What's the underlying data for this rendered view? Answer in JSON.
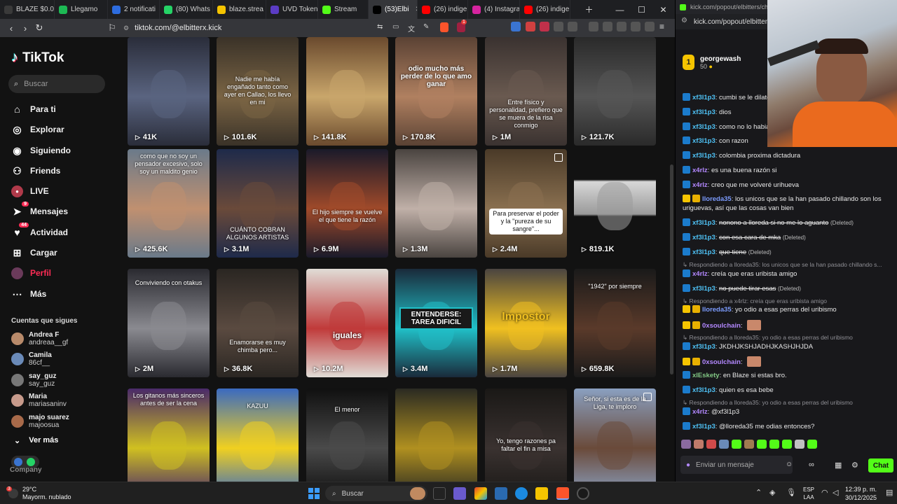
{
  "browser": {
    "tabs": [
      {
        "label": "BLAZE $0.0",
        "icon": "blaze-icon",
        "color": "#3a3a3a"
      },
      {
        "label": "Llegamo",
        "icon": "spotify-icon",
        "color": "#1db954"
      },
      {
        "label": "2 notificati",
        "icon": "notification-icon",
        "color": "#2d6cdf"
      },
      {
        "label": "(80) Whats",
        "icon": "whatsapp-icon",
        "color": "#25d366"
      },
      {
        "label": "blaze.strea",
        "icon": "document-icon",
        "color": "#f5c400"
      },
      {
        "label": "UVD Token",
        "icon": "token-icon",
        "color": "#5b3cc4"
      },
      {
        "label": "Stream",
        "icon": "kick-icon",
        "color": "#53fc18"
      },
      {
        "label": "(53)Elbi",
        "icon": "tiktok-icon",
        "color": "#000000",
        "active": true
      },
      {
        "label": "(26) indige",
        "icon": "youtube-icon",
        "color": "#ff0000"
      },
      {
        "label": "(4) Instagra",
        "icon": "instagram-icon",
        "color": "#d6249f"
      },
      {
        "label": "(26) indige",
        "icon": "youtube-icon",
        "color": "#ff0000"
      }
    ],
    "url": "tiktok.com/@elbitterx.kick",
    "brave_badge": "1"
  },
  "tiktok": {
    "logo": "TikTok",
    "search_placeholder": "Buscar",
    "nav": [
      {
        "label": "Para ti",
        "icon": "home-icon"
      },
      {
        "label": "Explorar",
        "icon": "compass-icon"
      },
      {
        "label": "Siguiendo",
        "icon": "following-icon"
      },
      {
        "label": "Friends",
        "icon": "friends-icon"
      },
      {
        "label": "LIVE",
        "icon": "live-icon"
      },
      {
        "label": "Mensajes",
        "icon": "messages-icon",
        "badge": "9"
      },
      {
        "label": "Actividad",
        "icon": "activity-icon",
        "badge": "44"
      },
      {
        "label": "Cargar",
        "icon": "upload-icon"
      },
      {
        "label": "Perfil",
        "icon": "profile-icon"
      },
      {
        "label": "Más",
        "icon": "more-icon"
      }
    ],
    "following_title": "Cuentas que sigues",
    "following": [
      {
        "name": "Andrea F",
        "handle": "andreaa__gf",
        "color": "#b88a6a"
      },
      {
        "name": "Camila",
        "handle": "86cf__",
        "color": "#6a8ab8"
      },
      {
        "name": "say_guz",
        "handle": "say_guz",
        "color": "#777777"
      },
      {
        "name": "Maria",
        "handle": "mariasaninv",
        "color": "#c79a8b"
      },
      {
        "name": "majo suarez",
        "handle": "majoosua",
        "color": "#a86a4a"
      }
    ],
    "see_more": "Ver más",
    "company": "Company",
    "videos": [
      {
        "views": "41K",
        "caption": "",
        "bg": "#2a2d3a",
        "accent": "#5a6480"
      },
      {
        "views": "101.6K",
        "caption": "Nadie me había engañado tanto como ayer en Callao, los llevo en mi",
        "bg": "#3a3228",
        "accent": "#7a6444"
      },
      {
        "views": "141.8K",
        "caption": "",
        "bg": "#6a4a2e",
        "accent": "#c9a66b"
      },
      {
        "views": "170.8K",
        "caption": "odio mucho más perder de lo que amo ganar",
        "bg": "#5a4234",
        "accent": "#b08060"
      },
      {
        "views": "1M",
        "caption": "Entre físico y personalidad, prefiero que se muera de la risa conmigo",
        "bg": "#3a3230",
        "accent": "#6a5a50"
      },
      {
        "views": "121.7K",
        "caption": "",
        "bg": "#2a2a2a",
        "accent": "#555555"
      },
      {
        "views": "425.6K",
        "caption": "como que no soy un pensador excesivo, solo soy un maldito genio",
        "bg": "#6a7a8a",
        "accent": "#c09070"
      },
      {
        "views": "3.1M",
        "caption": "CUÁNTO COBRAN ALGUNOS ARTISTAS",
        "bg": "#1e2a4a",
        "accent": "#6a4a3a"
      },
      {
        "views": "6.9M",
        "caption": "El hijo siempre se vuelve el que tiene la razón",
        "bg": "#1a1a2a",
        "accent": "#a04a2a"
      },
      {
        "views": "1.3M",
        "caption": "",
        "bg": "#4a4440",
        "accent": "#c0b0a8"
      },
      {
        "views": "2.4M",
        "caption": "Para preservar el poder y la \"pureza de su sangre\"...",
        "bg": "#4a3a28",
        "accent": "#8a7050"
      },
      {
        "views": "819.1K",
        "caption": "",
        "bg": "#121212",
        "accent": "#9a9a9a"
      },
      {
        "views": "2M",
        "caption": "Conviviendo con otakus",
        "bg": "#2a2a30",
        "accent": "#8a8a90"
      },
      {
        "views": "36.8K",
        "caption": "Enamorarse es muy chimba pero...",
        "bg": "#2a2622",
        "accent": "#5a4a40"
      },
      {
        "views": "10.2M",
        "caption": "iguales",
        "bg": "#e0dcd6",
        "accent": "#c03a3a"
      },
      {
        "views": "3.4M",
        "caption": "ENTENDERSE: TAREA DIFICIL",
        "bg": "#1a2a3a",
        "accent": "#20c0c8"
      },
      {
        "views": "1.7M",
        "caption": "Impostor",
        "bg": "#4a4440",
        "accent": "#f0c020"
      },
      {
        "views": "659.8K",
        "caption": "\"1942\" por siempre",
        "bg": "#1a1a1a",
        "accent": "#5a3a2a"
      },
      {
        "views": "",
        "caption": "Los gitanos más sinceros antes de ser la cena",
        "bg": "#4a2a6a",
        "accent": "#d0c020"
      },
      {
        "views": "",
        "caption": "KAZUU",
        "bg": "#3a6ac0",
        "accent": "#f0d020"
      },
      {
        "views": "",
        "caption": "El menor",
        "bg": "#101010",
        "accent": "#4a4a4a"
      },
      {
        "views": "",
        "caption": "",
        "bg": "#2a2a22",
        "accent": "#b09020"
      },
      {
        "views": "",
        "caption": "Yo, tengo razones pa faltar el fin a misa",
        "bg": "#1a1816",
        "accent": "#3a3230"
      },
      {
        "views": "",
        "caption": "Señor, si esta es de la Liga, te imploro",
        "bg": "#8aa0c0",
        "accent": "#6a4a3a"
      }
    ]
  },
  "kick": {
    "top_label": "kick.com/popout/elbitters/chat",
    "url": "kick.com/popout/elbitten",
    "pinned_user": "georgewash",
    "pinned_count": "50",
    "messages": [
      {
        "type": "msg",
        "user": "xf3l1p3",
        "badge": "#1b7bcc",
        "ucolor": "#4fc3f7",
        "text": "cumbi se le dilato"
      },
      {
        "type": "msg",
        "user": "xf3l1p3",
        "badge": "#1b7bcc",
        "ucolor": "#4fc3f7",
        "text": "dios"
      },
      {
        "type": "msg",
        "user": "xf3l1p3",
        "badge": "#1b7bcc",
        "ucolor": "#4fc3f7",
        "text": "como no lo habia"
      },
      {
        "type": "msg",
        "user": "xf3l1p3",
        "badge": "#1b7bcc",
        "ucolor": "#4fc3f7",
        "text": "con razon"
      },
      {
        "type": "msg",
        "user": "xf3l1p3",
        "badge": "#1b7bcc",
        "ucolor": "#4fc3f7",
        "text": "colombia proxima dictadura"
      },
      {
        "type": "msg",
        "user": "x4rlz",
        "badge": "#1b7bcc",
        "ucolor": "#b388ff",
        "text": "es una buena razón si"
      },
      {
        "type": "msg",
        "user": "x4rlz",
        "badge": "#1b7bcc",
        "ucolor": "#b388ff",
        "text": "creo que me volveré urihueva"
      },
      {
        "type": "msg",
        "user": "lloreda35",
        "badge": "#f5c400",
        "ucolor": "#7c9cff",
        "text": "los unicos que se la han pasado chillando son los uriguevas, así que las cosas van bien"
      },
      {
        "type": "msg",
        "user": "xf3l1p3",
        "badge": "#1b7bcc",
        "ucolor": "#4fc3f7",
        "text": "nonono a lloreda si no me lo aguanto",
        "deleted": "(Deleted)"
      },
      {
        "type": "msg",
        "user": "xf3l1p3",
        "badge": "#1b7bcc",
        "ucolor": "#4fc3f7",
        "text": "con esa cara de mka",
        "deleted": "(Deleted)"
      },
      {
        "type": "msg",
        "user": "xf3l1p3",
        "badge": "#1b7bcc",
        "ucolor": "#4fc3f7",
        "text": "que tiene",
        "deleted": "(Deleted)"
      },
      {
        "type": "reply",
        "text": "Respondiendo a lloreda35: los unicos que se la han pasado chillando s..."
      },
      {
        "type": "msg",
        "user": "x4rlz",
        "badge": "#1b7bcc",
        "ucolor": "#b388ff",
        "text": "creía que eras uribista amigo"
      },
      {
        "type": "msg",
        "user": "xf3l1p3",
        "badge": "#1b7bcc",
        "ucolor": "#4fc3f7",
        "text": "no puede tirar esas",
        "deleted": "(Deleted)"
      },
      {
        "type": "reply",
        "text": "Respondiendo a x4rlz: creía que eras uribista amigo"
      },
      {
        "type": "msg",
        "user": "lloreda35",
        "badge": "#f5c400",
        "ucolor": "#7c9cff",
        "text": "yo odio a esas perras del uribismo"
      },
      {
        "type": "msg",
        "user": "0xsoulchain",
        "badge": "#f5c400",
        "ucolor": "#b388ff",
        "text": "",
        "emote": true
      },
      {
        "type": "reply",
        "text": "Respondiendo a lloreda35: yo odio a esas perras del uribismo"
      },
      {
        "type": "msg",
        "user": "xf3l1p3",
        "badge": "#1b7bcc",
        "ucolor": "#4fc3f7",
        "text": "JKDHJKSHJADHJKASHJHJDA"
      },
      {
        "type": "msg",
        "user": "0xsoulchain",
        "badge": "#f5c400",
        "ucolor": "#b388ff",
        "text": "",
        "emote": true
      },
      {
        "type": "msg",
        "user": "xlEskety",
        "badge": "#1b7bcc",
        "ucolor": "#81c784",
        "text": "en Blaze si estas bro."
      },
      {
        "type": "msg",
        "user": "xf3l1p3",
        "badge": "#1b7bcc",
        "ucolor": "#4fc3f7",
        "text": "quien es esa bebe"
      },
      {
        "type": "reply",
        "text": "Respondiendo a lloreda35: yo odio a esas perras del uribismo"
      },
      {
        "type": "msg",
        "user": "x4rlz",
        "badge": "#1b7bcc",
        "ucolor": "#b388ff",
        "text": "@xf3l1p3"
      },
      {
        "type": "msg",
        "user": "xf3l1p3",
        "badge": "#1b7bcc",
        "ucolor": "#4fc3f7",
        "text": "@lloreda35 me odias entonces?"
      }
    ],
    "input_placeholder": "Enviar un mensaje",
    "chat_button": "Chat",
    "accent": "#53fc18"
  },
  "taskbar": {
    "weather_temp": "29°C",
    "weather_desc": "Mayorm. nublado",
    "weather_badge": "3",
    "search_placeholder": "Buscar",
    "lang": "ESP",
    "lang_sub": "LAA",
    "time": "12:39 p. m.",
    "date": "30/12/2025"
  }
}
